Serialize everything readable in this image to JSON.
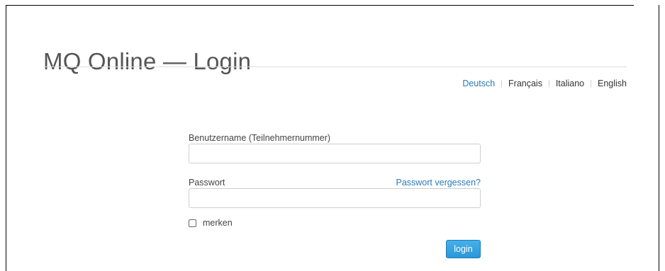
{
  "page": {
    "title": "MQ Online — Login"
  },
  "languages": [
    {
      "label": "Deutsch",
      "active": true
    },
    {
      "label": "Français",
      "active": false
    },
    {
      "label": "Italiano",
      "active": false
    },
    {
      "label": "English",
      "active": false
    }
  ],
  "login_form": {
    "username_label": "Benutzername (Teilnehmernummer)",
    "username_value": "",
    "password_label": "Passwort",
    "password_value": "",
    "forgot_password_label": "Passwort vergessen?",
    "remember_label": "merken",
    "remember_checked": false,
    "login_label": "login"
  },
  "colors": {
    "link": "#2a7ab8",
    "button": "#2b98d8",
    "title_text": "#555555"
  }
}
